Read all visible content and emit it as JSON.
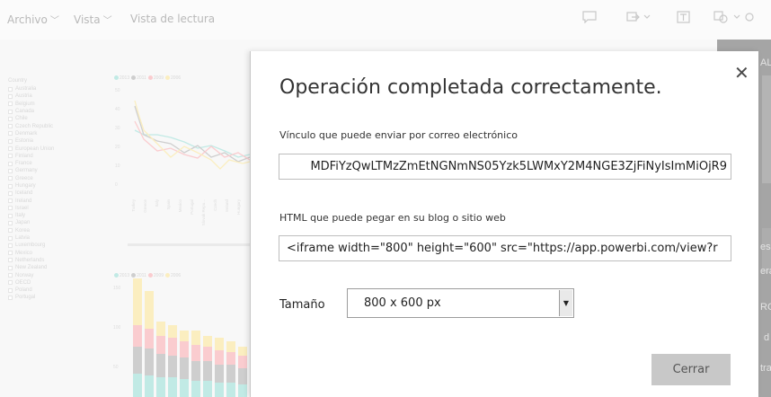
{
  "menubar": {
    "items": [
      {
        "label": "Archivo",
        "has_chevron": true
      },
      {
        "label": "Vista",
        "has_chevron": true
      },
      {
        "label": "Vista de lectura",
        "has_chevron": false
      }
    ],
    "icons": [
      "comment-icon",
      "export-icon",
      "textbox-icon",
      "shapes-icon"
    ]
  },
  "report": {
    "slicer_title": "Country",
    "countries": [
      "Australia",
      "Austria",
      "Belgium",
      "Canada",
      "Chile",
      "Czech Republic",
      "Denmark",
      "Estonia",
      "European Union",
      "Finland",
      "France",
      "Germany",
      "Greece",
      "Hungary",
      "Iceland",
      "Ireland",
      "Israel",
      "Italy",
      "Japan",
      "Korea",
      "Latvia",
      "Luxembourg",
      "Mexico",
      "Netherlands",
      "New Zealand",
      "Norway",
      "OECD",
      "Poland",
      "Portugal"
    ],
    "legend_years": [
      "2013",
      "2011",
      "2009",
      "2006"
    ],
    "legend_colors": [
      "#8fd9d0",
      "#a7a7a7",
      "#f6a3a8",
      "#f7e08c"
    ],
    "line_chart_yticks": [
      "50",
      "40",
      "30",
      "20",
      "10",
      "0"
    ],
    "line_chart_xlabels": [
      "Turkey",
      "Greece",
      "Italy",
      "Spain",
      "Mexico",
      "Portugal",
      "Slovak Repu...",
      "Czech",
      "Ireland",
      "Hungary"
    ],
    "bar_chart_yticks": [
      "150",
      "100",
      "50"
    ],
    "right_strip_texts": [
      "AL",
      "es",
      "era",
      "RC",
      "d",
      "tra"
    ]
  },
  "dialog": {
    "title": "Operación completada correctamente.",
    "email_link_label": "Vínculo que puede enviar por correo electrónico",
    "email_link_value": "MDFiYzQwLTMzZmEtNGNmNS05Yzk5LWMxY2M4NGE3ZjFiNyIsImMiOjR9",
    "embed_label": "HTML que puede pegar en su blog o sitio web",
    "embed_value": "<iframe width=\"800\" height=\"600\" src=\"https://app.powerbi.com/view?r",
    "size_label": "Tamaño",
    "size_selected": "800 x 600 px",
    "close_button": "Cerrar",
    "close_glyph": "✕"
  }
}
